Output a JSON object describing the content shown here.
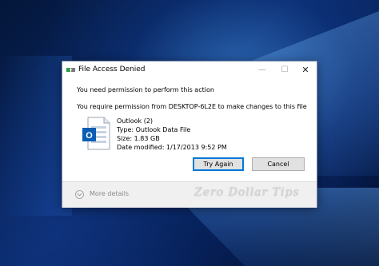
{
  "dialog": {
    "title": "File Access Denied",
    "controls": {
      "minimize": "—",
      "maximize": "☐",
      "close": "✕"
    },
    "message": "You need permission to perform this action",
    "permission_text": "You require permission from DESKTOP-6L2E to make changes to this file",
    "file": {
      "icon": "outlook-data-file-icon",
      "icon_letter": "O",
      "name": "Outlook (2)",
      "type": "Type: Outlook Data File",
      "size": "Size: 1.83 GB",
      "modified": "Date modified: 1/17/2013 9:52 PM"
    },
    "buttons": {
      "try_again": "Try Again",
      "cancel": "Cancel"
    },
    "more_details": "More details"
  },
  "watermark": "Zero Dollar Tips",
  "colors": {
    "accent": "#0078d7",
    "outlook_blue": "#0b5db3",
    "desktop": "#0a2a67"
  }
}
